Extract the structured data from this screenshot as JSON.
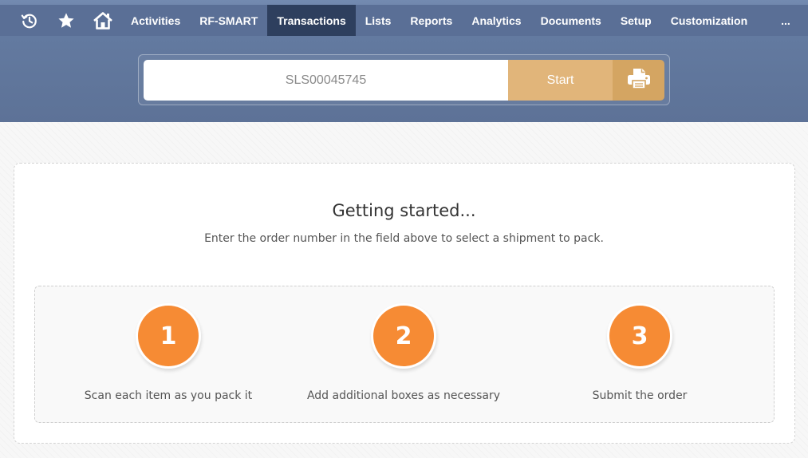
{
  "nav": {
    "icons": [
      "recent-history-icon",
      "star-icon",
      "home-icon"
    ],
    "items": [
      {
        "label": "Activities",
        "active": false
      },
      {
        "label": "RF-SMART",
        "active": false
      },
      {
        "label": "Transactions",
        "active": true
      },
      {
        "label": "Lists",
        "active": false
      },
      {
        "label": "Reports",
        "active": false
      },
      {
        "label": "Analytics",
        "active": false
      },
      {
        "label": "Documents",
        "active": false
      },
      {
        "label": "Setup",
        "active": false
      },
      {
        "label": "Customization",
        "active": false
      }
    ],
    "more_label": "..."
  },
  "search": {
    "value": "SLS00045745",
    "start_label": "Start",
    "print_icon": "printer-icon"
  },
  "intro": {
    "title": "Getting started...",
    "subtitle": "Enter the order number in the field above to select a shipment to pack."
  },
  "steps": [
    {
      "number": "1",
      "label": "Scan each item as you pack it"
    },
    {
      "number": "2",
      "label": "Add additional boxes as necessary"
    },
    {
      "number": "3",
      "label": "Submit the order"
    }
  ],
  "colors": {
    "nav_bg": "#5a6f96",
    "nav_active": "#2e3f5e",
    "start_button": "#e1b57a",
    "print_button": "#d4a562",
    "step_circle": "#f68b34"
  }
}
